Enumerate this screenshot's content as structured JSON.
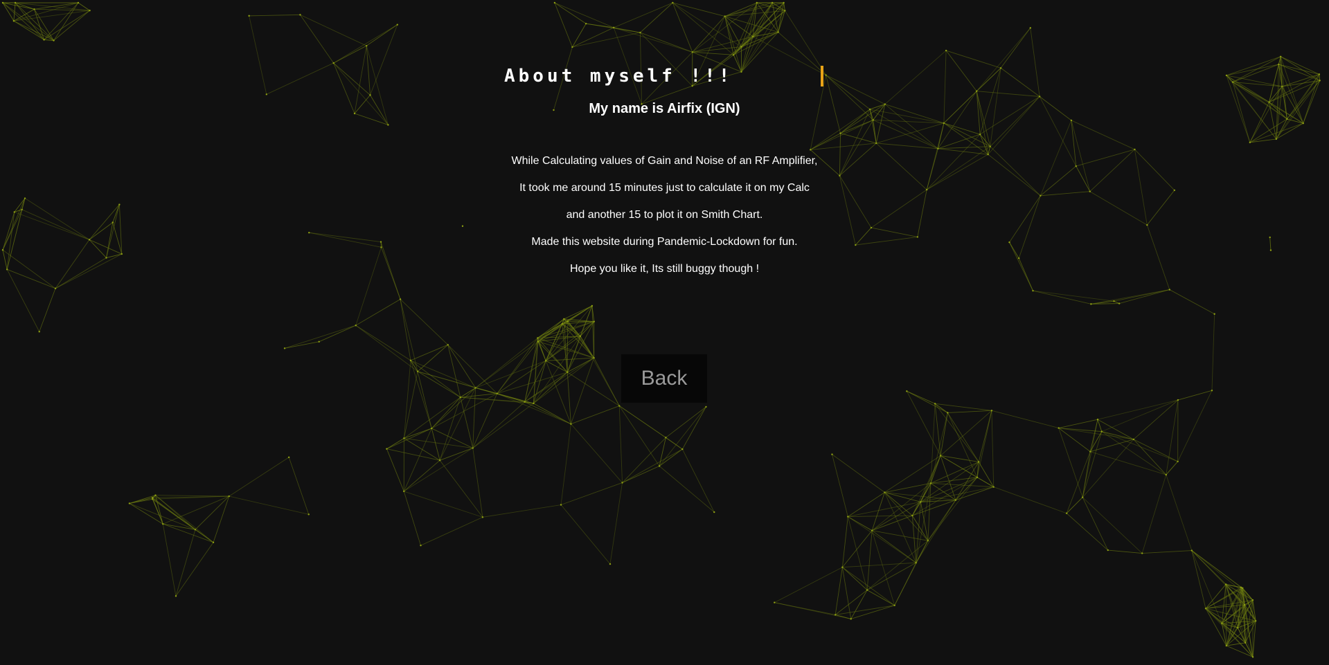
{
  "page": {
    "title": "About myself !!!",
    "name_line": "My name is Airfix (IGN)",
    "paragraphs": [
      "While Calculating values of Gain and Noise of an RF Amplifier,",
      "It took me around 15 minutes just to calculate it on my Calc",
      "and another 15 to plot it on Smith Chart.",
      "Made this website during Pandemic-Lockdown for fun.",
      "Hope you like it, Its still buggy though !"
    ],
    "back_button": "Back"
  },
  "colors": {
    "background": "#111111",
    "network_line": "#6b7a10",
    "caret": "#e8a317",
    "text": "#ffffff",
    "button_text": "#9a9a9a"
  }
}
